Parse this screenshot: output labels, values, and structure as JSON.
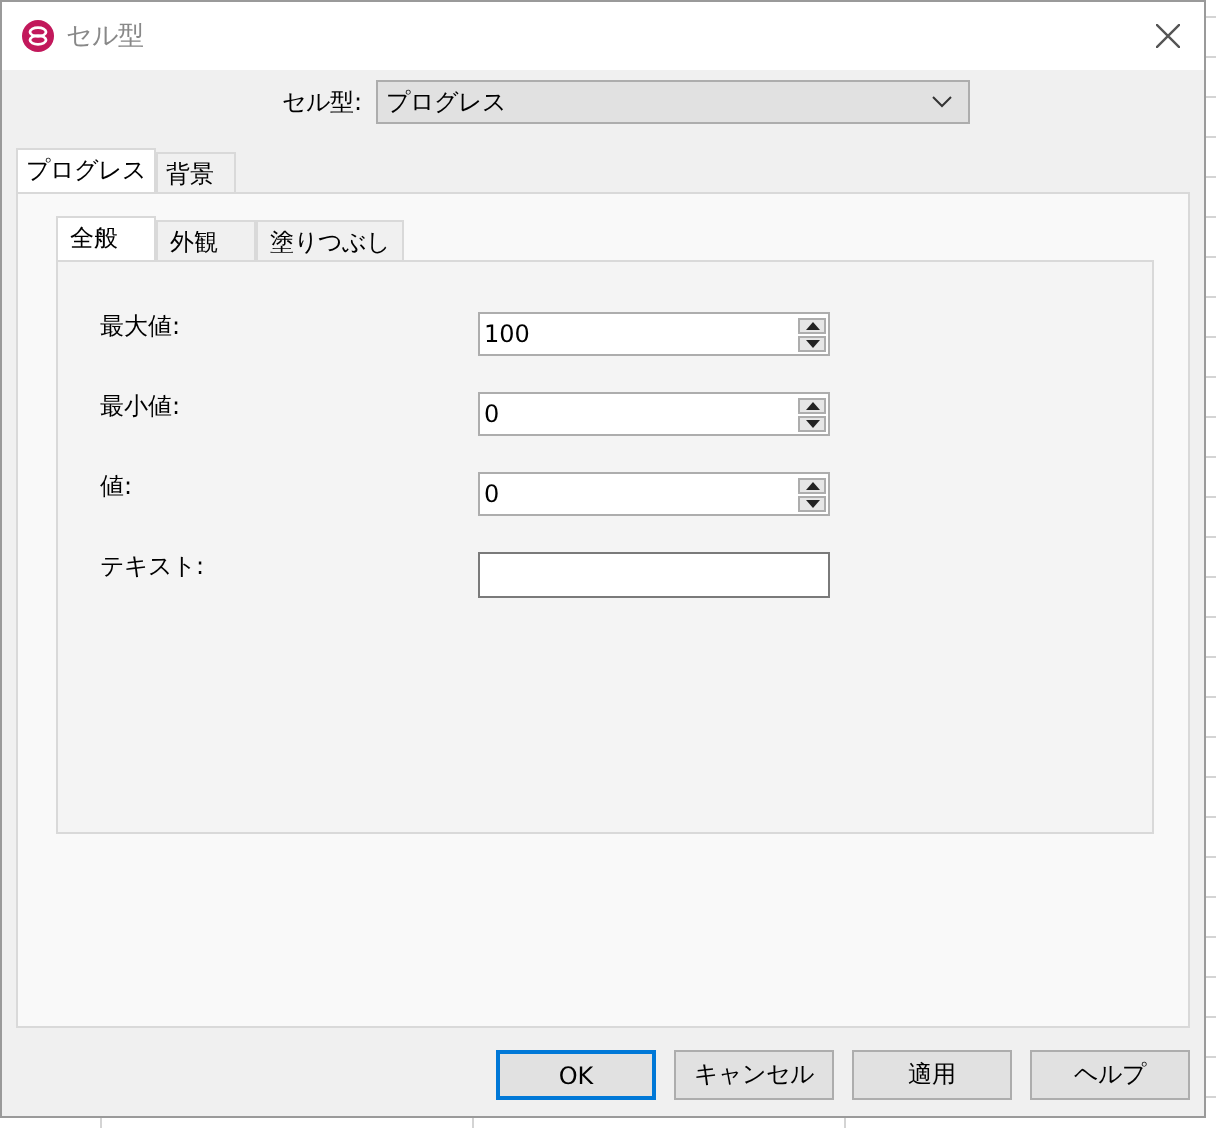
{
  "window": {
    "title": "セル型"
  },
  "cell_type": {
    "label": "セル型:",
    "value": "プログレス"
  },
  "outer_tabs": [
    {
      "label": "プログレス",
      "selected": true
    },
    {
      "label": "背景",
      "selected": false
    }
  ],
  "inner_tabs": [
    {
      "label": "全般",
      "selected": true
    },
    {
      "label": "外観",
      "selected": false
    },
    {
      "label": "塗りつぶし",
      "selected": false
    }
  ],
  "fields": [
    {
      "label": "最大値:",
      "kind": "spinner",
      "value": "100"
    },
    {
      "label": "最小値:",
      "kind": "spinner",
      "value": "0"
    },
    {
      "label": "値:",
      "kind": "spinner",
      "value": "0"
    },
    {
      "label": "テキスト:",
      "kind": "text"
    }
  ],
  "buttons": [
    {
      "label": "OK",
      "default": true
    },
    {
      "label": "キャンセル",
      "default": false
    },
    {
      "label": "適用",
      "default": false
    },
    {
      "label": "ヘルプ",
      "default": false
    }
  ]
}
